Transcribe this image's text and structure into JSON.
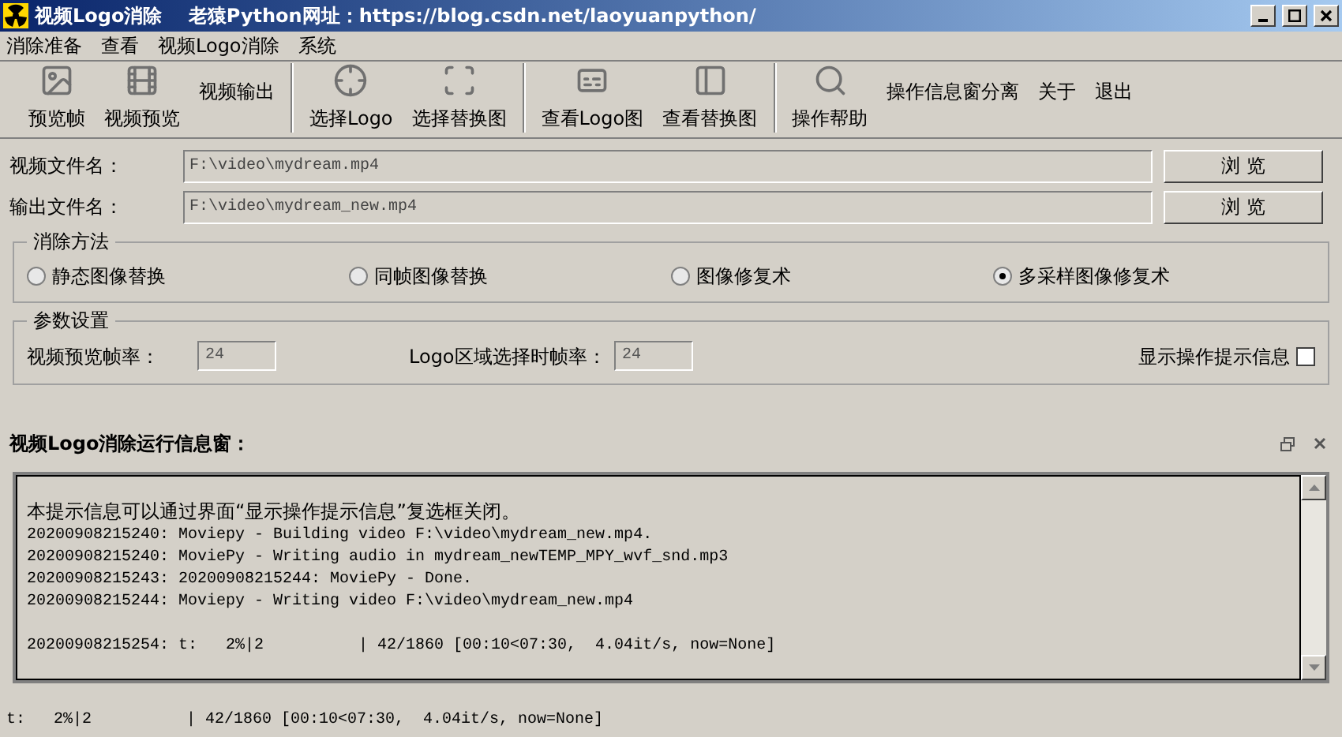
{
  "window": {
    "title": "视频Logo消除    老猿Python网址：https://blog.csdn.net/laoyuanpython/"
  },
  "menu": [
    "消除准备",
    "查看",
    "视频Logo消除",
    "系统"
  ],
  "toolbar": [
    {
      "label": "预览帧",
      "kind": "picture-frame"
    },
    {
      "label": "视频预览",
      "kind": "film-reel"
    },
    {
      "label": "视频输出",
      "kind": "text"
    },
    {
      "label": "选择Logo",
      "kind": "crosshair"
    },
    {
      "label": "选择替换图",
      "kind": "scan"
    },
    {
      "label": "查看Logo图",
      "kind": "subtitles"
    },
    {
      "label": "查看替换图",
      "kind": "panel"
    },
    {
      "label": "操作帮助",
      "kind": "magnifier"
    },
    {
      "label": "操作信息窗分离",
      "kind": "text"
    },
    {
      "label": "关于",
      "kind": "text"
    },
    {
      "label": "退出",
      "kind": "text"
    }
  ],
  "files": [
    {
      "label": "视频文件名：",
      "value": "F:\\video\\mydream.mp4",
      "button": "浏 览"
    },
    {
      "label": "输出文件名：",
      "value": "F:\\video\\mydream_new.mp4",
      "button": "浏 览"
    }
  ],
  "method": {
    "title": "消除方法",
    "options": [
      {
        "label": "静态图像替换",
        "selected": false
      },
      {
        "label": "同帧图像替换",
        "selected": false
      },
      {
        "label": "图像修复术",
        "selected": false
      },
      {
        "label": "多采样图像修复术",
        "selected": true
      }
    ]
  },
  "params": {
    "title": "参数设置",
    "preview_rate": {
      "label": "视频预览帧率：",
      "value": "24"
    },
    "logo_rate": {
      "label": "Logo区域选择时帧率：",
      "value": "24"
    },
    "show_tips": {
      "label": "显示操作提示信息",
      "checked": false
    }
  },
  "info": {
    "title": "视频Logo消除运行信息窗：",
    "lines": [
      "本提示信息可以通过界面“显示操作提示信息”复选框关闭。",
      "20200908215240: Moviepy - Building video F:\\video\\mydream_new.mp4.",
      "20200908215240: MoviePy - Writing audio in mydream_newTEMP_MPY_wvf_snd.mp3",
      "20200908215243: 20200908215244: MoviePy - Done.",
      "20200908215244: Moviepy - Writing video F:\\video\\mydream_new.mp4"
    ],
    "progress_line": "20200908215254: t:   2%|2          | 42/1860 [00:10<07:30,  4.04it/s, now=None]"
  },
  "status_bar": "t:   2%|2          | 42/1860 [00:10<07:30,  4.04it/s, now=None]"
}
